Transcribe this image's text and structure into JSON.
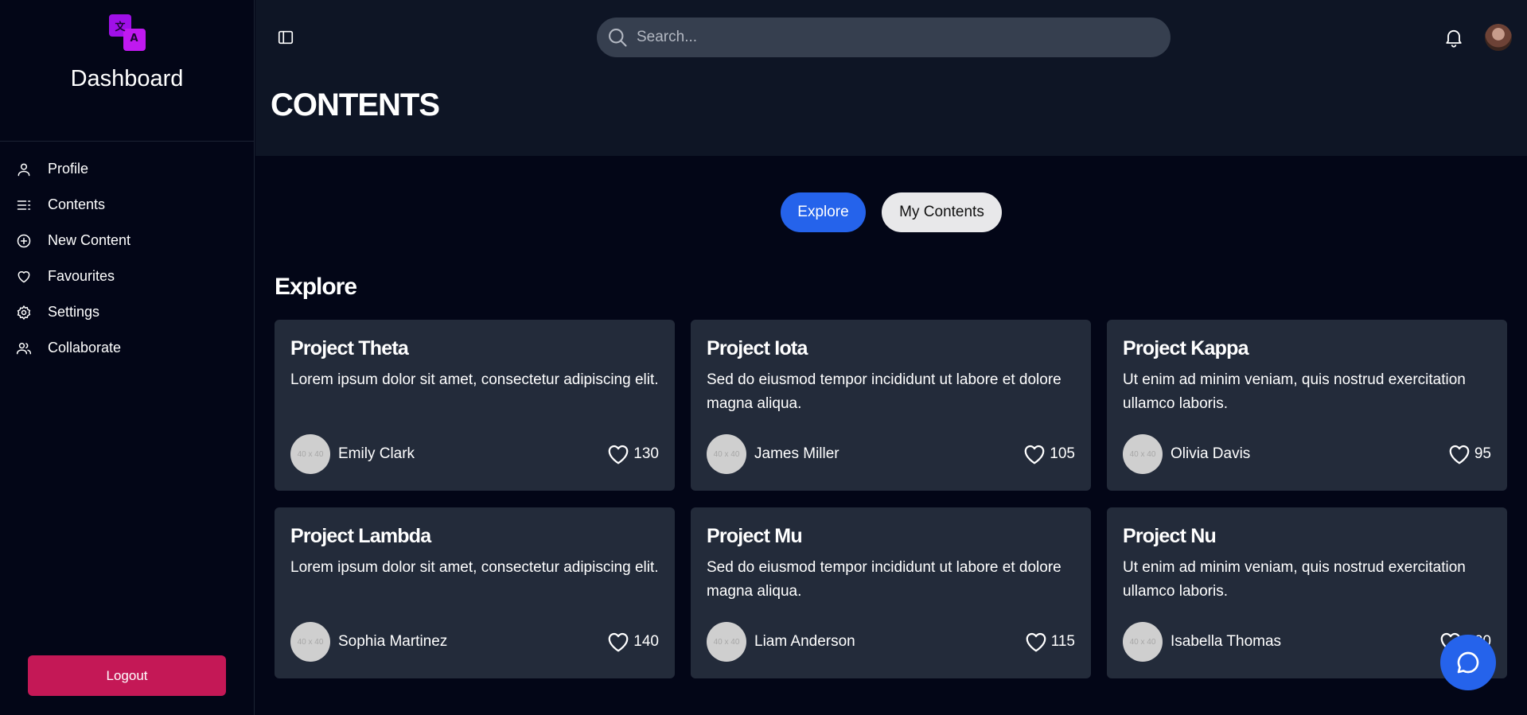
{
  "sidebar": {
    "brand_title": "Dashboard",
    "logo_glyphs": [
      "文",
      "A"
    ],
    "items": [
      {
        "label": "Profile",
        "icon": "user-icon"
      },
      {
        "label": "Contents",
        "icon": "list-icon"
      },
      {
        "label": "New Content",
        "icon": "plus-circle-icon"
      },
      {
        "label": "Favourites",
        "icon": "heart-icon"
      },
      {
        "label": "Settings",
        "icon": "gear-icon"
      },
      {
        "label": "Collaborate",
        "icon": "users-icon"
      }
    ],
    "logout_label": "Logout"
  },
  "header": {
    "search_placeholder": "Search...",
    "page_title": "CONTENTS"
  },
  "tabs": [
    {
      "label": "Explore",
      "active": true
    },
    {
      "label": "My Contents",
      "active": false
    }
  ],
  "section_title": "Explore",
  "cards": [
    {
      "title": "Project Theta",
      "description": "Lorem ipsum dolor sit amet, consectetur adipiscing elit.",
      "author": "Emily Clark",
      "avatar_text": "40 x 40",
      "likes": "130"
    },
    {
      "title": "Project Iota",
      "description": "Sed do eiusmod tempor incididunt ut labore et dolore magna aliqua.",
      "author": "James Miller",
      "avatar_text": "40 x 40",
      "likes": "105"
    },
    {
      "title": "Project Kappa",
      "description": "Ut enim ad minim veniam, quis nostrud exercitation ullamco laboris.",
      "author": "Olivia Davis",
      "avatar_text": "40 x 40",
      "likes": "95"
    },
    {
      "title": "Project Lambda",
      "description": "Lorem ipsum dolor sit amet, consectetur adipiscing elit.",
      "author": "Sophia Martinez",
      "avatar_text": "40 x 40",
      "likes": "140"
    },
    {
      "title": "Project Mu",
      "description": "Sed do eiusmod tempor incididunt ut labore et dolore magna aliqua.",
      "author": "Liam Anderson",
      "avatar_text": "40 x 40",
      "likes": "115"
    },
    {
      "title": "Project Nu",
      "description": "Ut enim ad minim veniam, quis nostrud exercitation ullamco laboris.",
      "author": "Isabella Thomas",
      "avatar_text": "40 x 40",
      "likes": "120"
    }
  ],
  "colors": {
    "background": "#030617",
    "header": "#0e1525",
    "card": "#232b3a",
    "accent": "#2563eb",
    "logout": "#c41856"
  }
}
